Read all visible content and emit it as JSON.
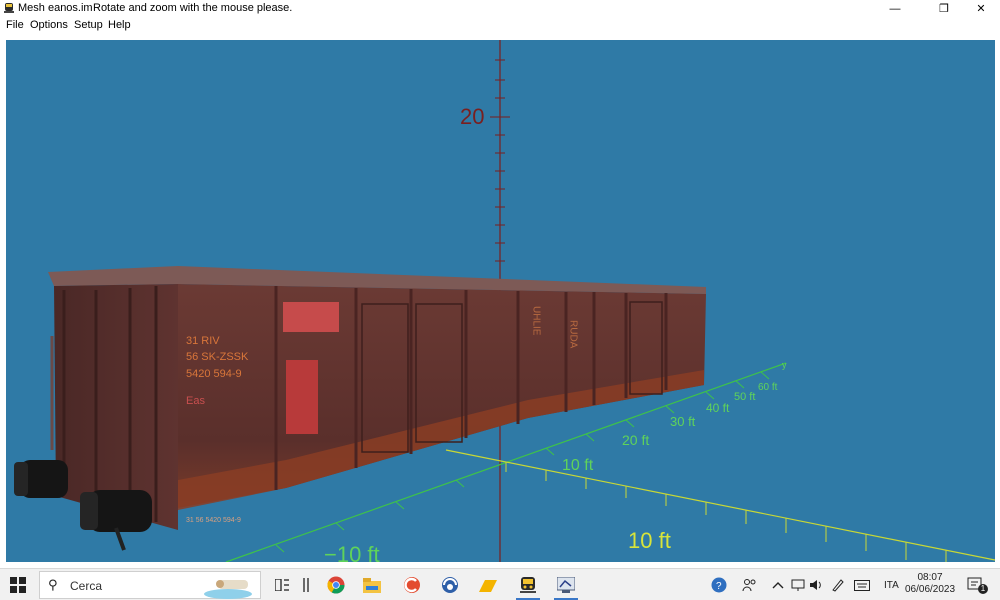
{
  "window": {
    "title": "Mesh eanos.im",
    "message": "Rotate and zoom with the mouse please.",
    "controls": {
      "minimize": "—",
      "restore": "❐",
      "close": "✕"
    }
  },
  "menu": {
    "items": [
      "File",
      "Options",
      "Setup",
      "Help"
    ]
  },
  "viewport": {
    "background": "#2f7aa6",
    "axis_labels": {
      "z_20": "20",
      "ft_left_10": "10 ft",
      "ft_center_10": "10 ft",
      "ft_20": "20 ft",
      "ft_30": "30 ft",
      "ft_40": "40 ft",
      "ft_50": "50 ft",
      "ft_60": "60 ft",
      "ft_neg10": "−10 ft",
      "ft_front_10": "10 ft",
      "y_axis": "y"
    },
    "wagon_markings": {
      "line1": "31  RIV",
      "line2": "56  SK-ZSSK",
      "line3": "5420  594-9",
      "line4": "Eas",
      "side_1": "UHLIE",
      "side_2": "RUDA",
      "bottom": "31  56  5420  594-9"
    },
    "axis_colors": {
      "z": "#7a1f1f",
      "x": "#c8d835",
      "y": "#3ec24a",
      "label_z": "#7a1f1f",
      "label_y": "#5fd35a",
      "label_x": "#d8e43a"
    }
  },
  "taskbar": {
    "search_placeholder": "Cerca",
    "language": "ITA",
    "time": "08:07",
    "date": "06/06/2023",
    "notification_count": "1"
  }
}
